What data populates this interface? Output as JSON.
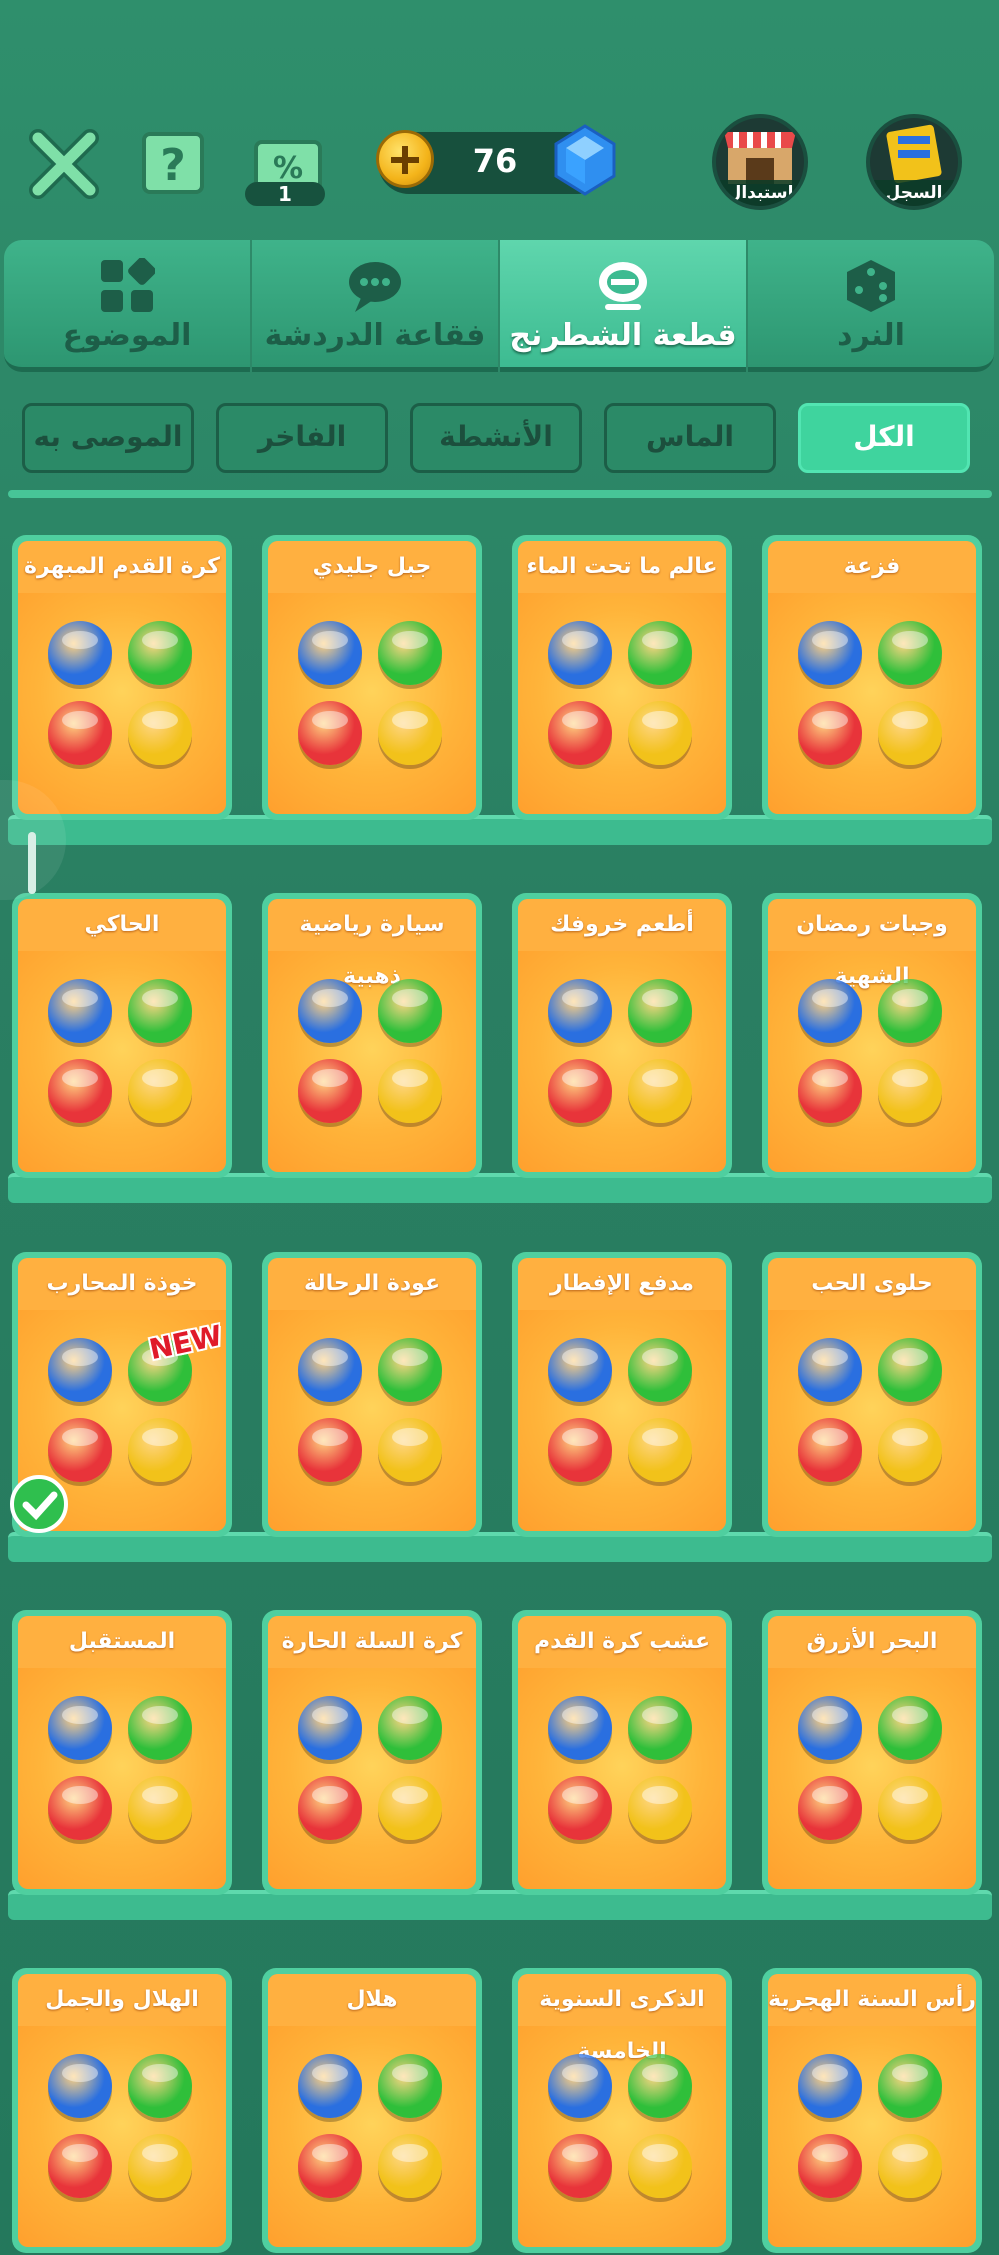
{
  "colors": {
    "red": "#e8343a",
    "green": "#2fbf3a",
    "blue": "#2a6fe0",
    "yellow": "#f2c21a",
    "tab_active": "#3dbb91",
    "filter_active": "#3fd49e"
  },
  "topbar": {
    "coupon_count": "1",
    "currency_value": "76",
    "redeem_label": "استبدال",
    "record_label": "السجل"
  },
  "tabs": [
    "الموضوع",
    "فقاعة الدردشة",
    "قطعة الشطرنج",
    "النرد"
  ],
  "filters": [
    "الموصى به",
    "الفاخر",
    "الأنشطة",
    "الماس",
    "الكل"
  ],
  "new_label": "NEW",
  "cards": [
    {
      "title": "كرة القدم المبهرة"
    },
    {
      "title": "جبل جليدي"
    },
    {
      "title": "عالم ما تحت الماء"
    },
    {
      "title": "فزعة"
    },
    {
      "title": "الحاكي"
    },
    {
      "title": "سيارة رياضية ذهبية"
    },
    {
      "title": "أطعم خروفك"
    },
    {
      "title": "وجبات رمضان الشهية"
    },
    {
      "title": "خوذة المحارب"
    },
    {
      "title": "عودة الرحالة"
    },
    {
      "title": "مدفع الإفطار"
    },
    {
      "title": "حلوى الحب"
    },
    {
      "title": "المستقبل"
    },
    {
      "title": "كرة السلة الحارة"
    },
    {
      "title": "عشب كرة القدم"
    },
    {
      "title": "البحر الأزرق"
    },
    {
      "title": "الهلال والجمل"
    },
    {
      "title": "هلال"
    },
    {
      "title": "الذكرى السنوية الخامسة"
    },
    {
      "title": "رأس السنة الهجرية"
    }
  ]
}
